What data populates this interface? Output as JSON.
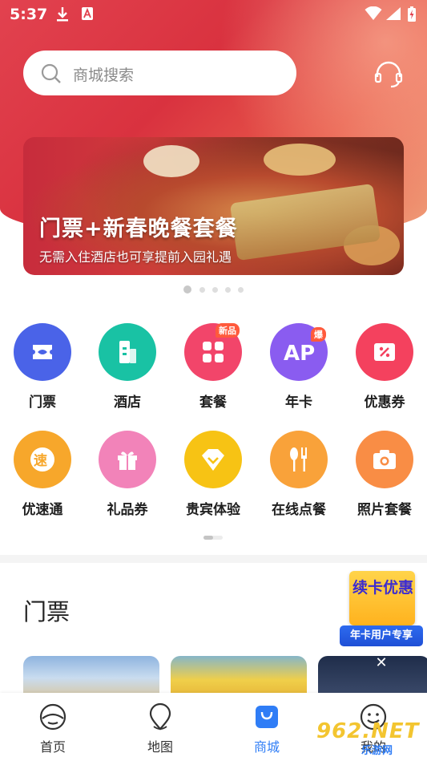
{
  "status_bar": {
    "time": "5:37",
    "icons": [
      "download-icon",
      "a-notification-icon",
      "wifi-icon",
      "signal-icon",
      "battery-charging-icon"
    ]
  },
  "search": {
    "placeholder": "商城搜索",
    "icon": "search-icon"
  },
  "header": {
    "service_icon": "headset-icon"
  },
  "banner": {
    "title": "门票+新春晚餐套餐",
    "subtitle": "无需入住酒店也可享提前入园礼遇",
    "page_count": 5,
    "active_index": 0
  },
  "categories": [
    {
      "label": "门票",
      "icon": "ticket-icon",
      "color": "#4a63e8"
    },
    {
      "label": "酒店",
      "icon": "hotel-icon",
      "color": "#19c2a4"
    },
    {
      "label": "套餐",
      "icon": "grid-icon",
      "color": "#f2456a",
      "badge": "新品"
    },
    {
      "label": "年卡",
      "icon": "ap-icon",
      "color": "#8a5cf0",
      "badge": "爆"
    },
    {
      "label": "优惠券",
      "icon": "coupon-icon",
      "color": "#f4415e"
    },
    {
      "label": "优速通",
      "icon": "express-icon",
      "color": "#f7a72b"
    },
    {
      "label": "礼品券",
      "icon": "gift-icon",
      "color": "#f283b9"
    },
    {
      "label": "贵宾体验",
      "icon": "vip-icon",
      "color": "#f7c314"
    },
    {
      "label": "在线点餐",
      "icon": "dining-icon",
      "color": "#f9a23a"
    },
    {
      "label": "照片套餐",
      "icon": "camera-icon",
      "color": "#f98d45"
    }
  ],
  "section": {
    "title": "门票"
  },
  "promo": {
    "card_text": "续卡优惠",
    "ribbon": "年卡用户专享"
  },
  "tabbar": {
    "items": [
      {
        "label": "首页",
        "icon": "home-icon",
        "active": false
      },
      {
        "label": "地图",
        "icon": "map-pin-icon",
        "active": false
      },
      {
        "label": "商城",
        "icon": "shopping-bag-icon",
        "active": true
      },
      {
        "label": "我的",
        "icon": "smile-icon",
        "active": false
      }
    ],
    "active_color": "#2f7df6"
  },
  "watermark": {
    "big": "962.NET",
    "small": "乐游网"
  }
}
